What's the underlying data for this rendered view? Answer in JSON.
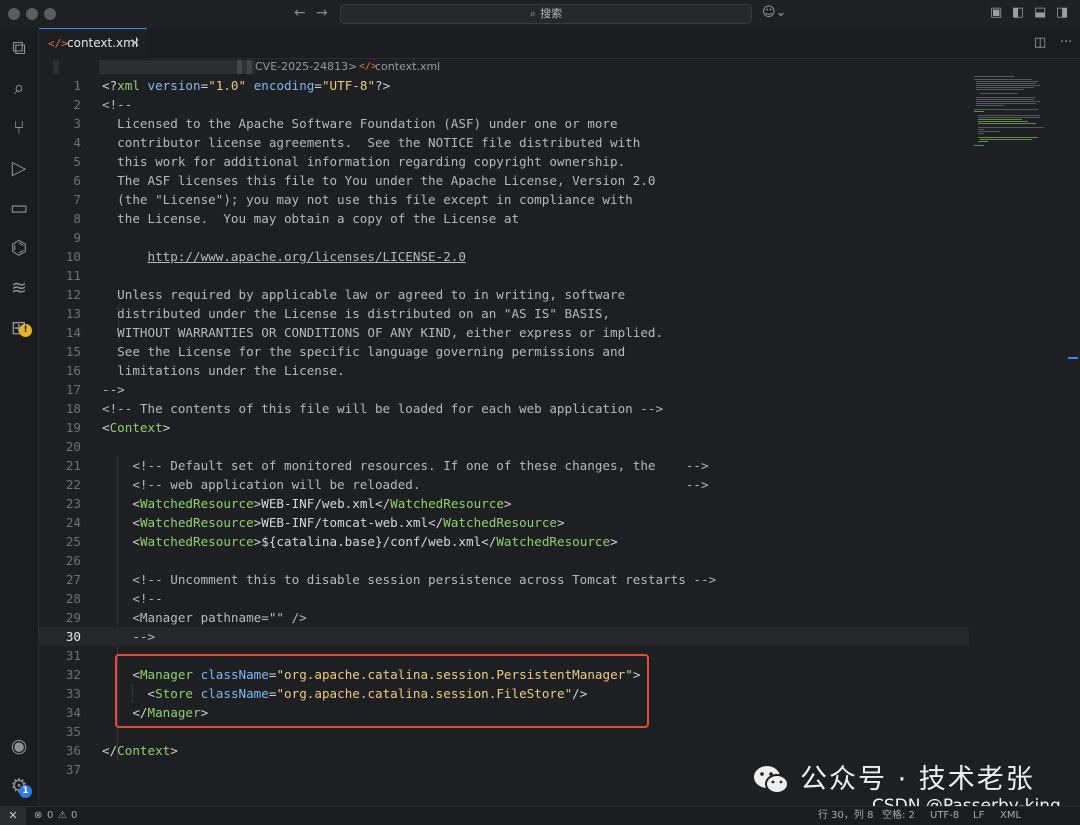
{
  "titlebar": {
    "search_text": "搜索",
    "back_icon": "arrow-left-icon",
    "forward_icon": "arrow-right-icon"
  },
  "activity_icons": [
    "files-icon",
    "search-icon",
    "source-control-icon",
    "run-debug-icon",
    "remote-explorer-icon",
    "python-icon",
    "docker-icon",
    "extensions-icon",
    "account-icon",
    "settings-icon"
  ],
  "tab": {
    "label": "context.xml"
  },
  "breadcrumb": {
    "folder": "CVE-2025-24813",
    "separator": ">",
    "file": "context.xml"
  },
  "editor": {
    "current_line": 30,
    "lines": [
      {
        "n": "1",
        "text": "<?xml version=\"1.0\" encoding=\"UTF-8\"?>"
      },
      {
        "n": "2",
        "text": "<!--"
      },
      {
        "n": "3",
        "text": "  Licensed to the Apache Software Foundation (ASF) under one or more"
      },
      {
        "n": "4",
        "text": "  contributor license agreements.  See the NOTICE file distributed with"
      },
      {
        "n": "5",
        "text": "  this work for additional information regarding copyright ownership."
      },
      {
        "n": "6",
        "text": "  The ASF licenses this file to You under the Apache License, Version 2.0"
      },
      {
        "n": "7",
        "text": "  (the \"License\"); you may not use this file except in compliance with"
      },
      {
        "n": "8",
        "text": "  the License.  You may obtain a copy of the License at"
      },
      {
        "n": "9",
        "text": ""
      },
      {
        "n": "10",
        "text": "      http://www.apache.org/licenses/LICENSE-2.0"
      },
      {
        "n": "11",
        "text": ""
      },
      {
        "n": "12",
        "text": "  Unless required by applicable law or agreed to in writing, software"
      },
      {
        "n": "13",
        "text": "  distributed under the License is distributed on an \"AS IS\" BASIS,"
      },
      {
        "n": "14",
        "text": "  WITHOUT WARRANTIES OR CONDITIONS OF ANY KIND, either express or implied."
      },
      {
        "n": "15",
        "text": "  See the License for the specific language governing permissions and"
      },
      {
        "n": "16",
        "text": "  limitations under the License."
      },
      {
        "n": "17",
        "text": "-->"
      },
      {
        "n": "18",
        "text": "<!-- The contents of this file will be loaded for each web application -->"
      },
      {
        "n": "19",
        "text": "<Context>"
      },
      {
        "n": "20",
        "text": ""
      },
      {
        "n": "21",
        "text": "    <!-- Default set of monitored resources. If one of these changes, the    -->"
      },
      {
        "n": "22",
        "text": "    <!-- web application will be reloaded.                                   -->"
      },
      {
        "n": "23",
        "text": "    <WatchedResource>WEB-INF/web.xml</WatchedResource>"
      },
      {
        "n": "24",
        "text": "    <WatchedResource>WEB-INF/tomcat-web.xml</WatchedResource>"
      },
      {
        "n": "25",
        "text": "    <WatchedResource>${catalina.base}/conf/web.xml</WatchedResource>"
      },
      {
        "n": "26",
        "text": ""
      },
      {
        "n": "27",
        "text": "    <!-- Uncomment this to disable session persistence across Tomcat restarts -->"
      },
      {
        "n": "28",
        "text": "    <!--"
      },
      {
        "n": "29",
        "text": "    <Manager pathname=\"\" />"
      },
      {
        "n": "30",
        "text": "    -->"
      },
      {
        "n": "31",
        "text": ""
      },
      {
        "n": "32",
        "text": "    <Manager className=\"org.apache.catalina.session.PersistentManager\">"
      },
      {
        "n": "33",
        "text": "      <Store className=\"org.apache.catalina.session.FileStore\"/>"
      },
      {
        "n": "34",
        "text": "    </Manager>"
      },
      {
        "n": "35",
        "text": ""
      },
      {
        "n": "36",
        "text": "</Context>"
      },
      {
        "n": "37",
        "text": ""
      }
    ]
  },
  "statusbar": {
    "errors": "0",
    "warnings": "0",
    "position": "行 30，列 8",
    "indent": "空格: 2",
    "encoding": "UTF-8",
    "eol": "LF",
    "language": "XML"
  },
  "watermark": {
    "line1": "公众号 · 技术老张",
    "line2": "CSDN @Passerby-king"
  },
  "colors": {
    "highlight_box": "#e14d3a",
    "tag": "#8fd16b",
    "attribute": "#7fb9f0",
    "string": "#eecb7d"
  }
}
